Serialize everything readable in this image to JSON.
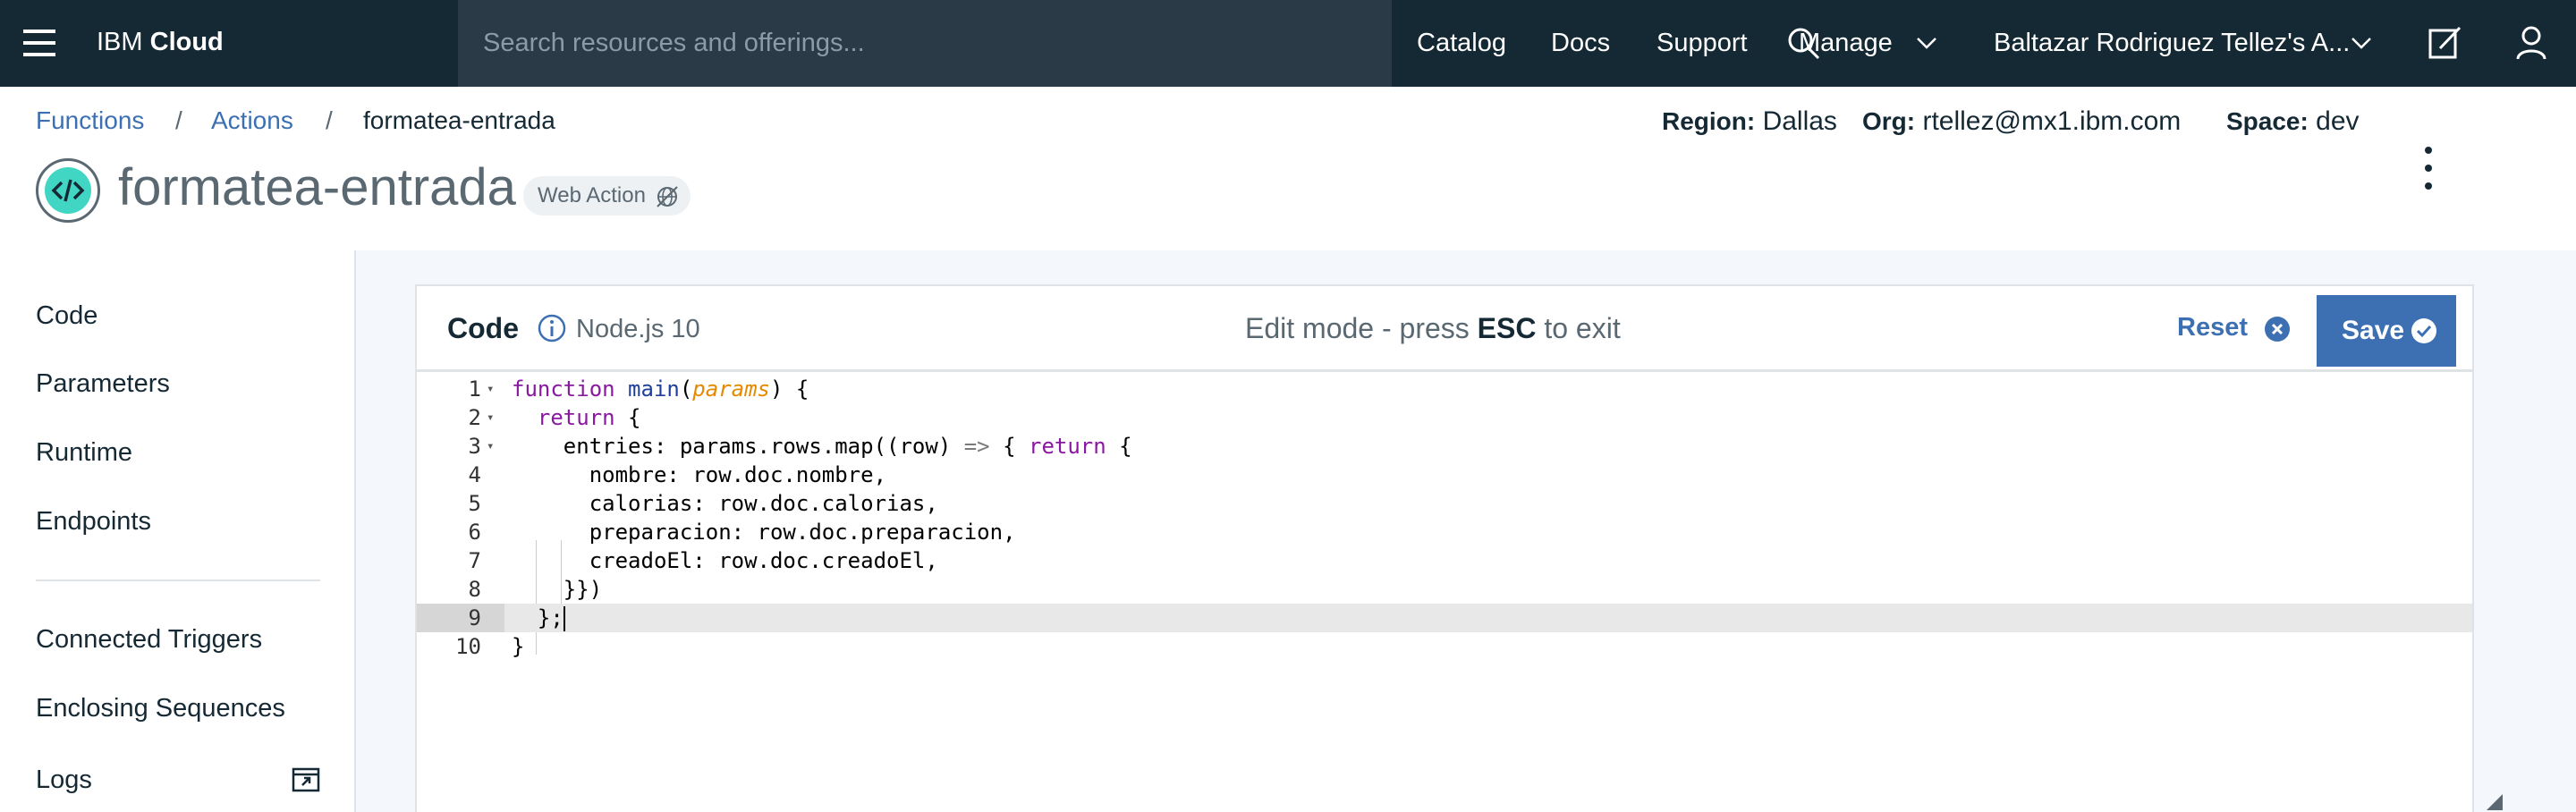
{
  "topbar": {
    "brand_prefix": "IBM ",
    "brand_bold": "Cloud",
    "search_placeholder": "Search resources and offerings...",
    "links": {
      "catalog": "Catalog",
      "docs": "Docs",
      "support": "Support",
      "manage": "Manage",
      "account": "Baltazar Rodriguez Tellez's A..."
    }
  },
  "breadcrumb": {
    "functions": "Functions",
    "actions": "Actions",
    "current": "formatea-entrada",
    "separator": "/"
  },
  "meta": {
    "region_label": "Region:",
    "region_value": "Dallas",
    "org_label": "Org:",
    "org_value": "rtellez@mx1.ibm.com",
    "space_label": "Space:",
    "space_value": "dev"
  },
  "action": {
    "title": "formatea-entrada",
    "badge": "Web Action"
  },
  "sidebar": {
    "items": [
      "Code",
      "Parameters",
      "Runtime",
      "Endpoints",
      "Connected Triggers",
      "Enclosing Sequences",
      "Logs"
    ]
  },
  "panel": {
    "title": "Code",
    "runtime": "Node.js 10",
    "hint_prefix": "Edit mode - press ",
    "hint_key": "ESC",
    "hint_suffix": " to exit",
    "reset_label": "Reset",
    "save_label": "Save"
  },
  "editor": {
    "active_line": 9,
    "lines": [
      {
        "n": "1",
        "code": "function main(params) {"
      },
      {
        "n": "2",
        "code": "  return {"
      },
      {
        "n": "3",
        "code": "    entries: params.rows.map((row) => { return {"
      },
      {
        "n": "4",
        "code": "      nombre: row.doc.nombre,"
      },
      {
        "n": "5",
        "code": "      calorias: row.doc.calorias,"
      },
      {
        "n": "6",
        "code": "      preparacion: row.doc.preparacion,"
      },
      {
        "n": "7",
        "code": "      creadoEl: row.doc.creadoEl,"
      },
      {
        "n": "8",
        "code": "    }})"
      },
      {
        "n": "9",
        "code": "  };"
      },
      {
        "n": "10",
        "code": "}"
      }
    ]
  },
  "colors": {
    "topbar_bg": "#152935",
    "search_bg": "#2a3b47",
    "link_blue": "#3d70b2",
    "accent_teal": "#41d6c3",
    "keyword_purple": "#8a18a2",
    "param_orange": "#e58a00"
  },
  "icons": [
    "menu-icon",
    "search-icon",
    "chevron-down-icon",
    "edit-icon",
    "user-icon",
    "code-icon",
    "web-action-icon",
    "info-icon",
    "close-circle-icon",
    "checkmark-circle-icon",
    "kebab-menu-icon",
    "launch-icon"
  ]
}
